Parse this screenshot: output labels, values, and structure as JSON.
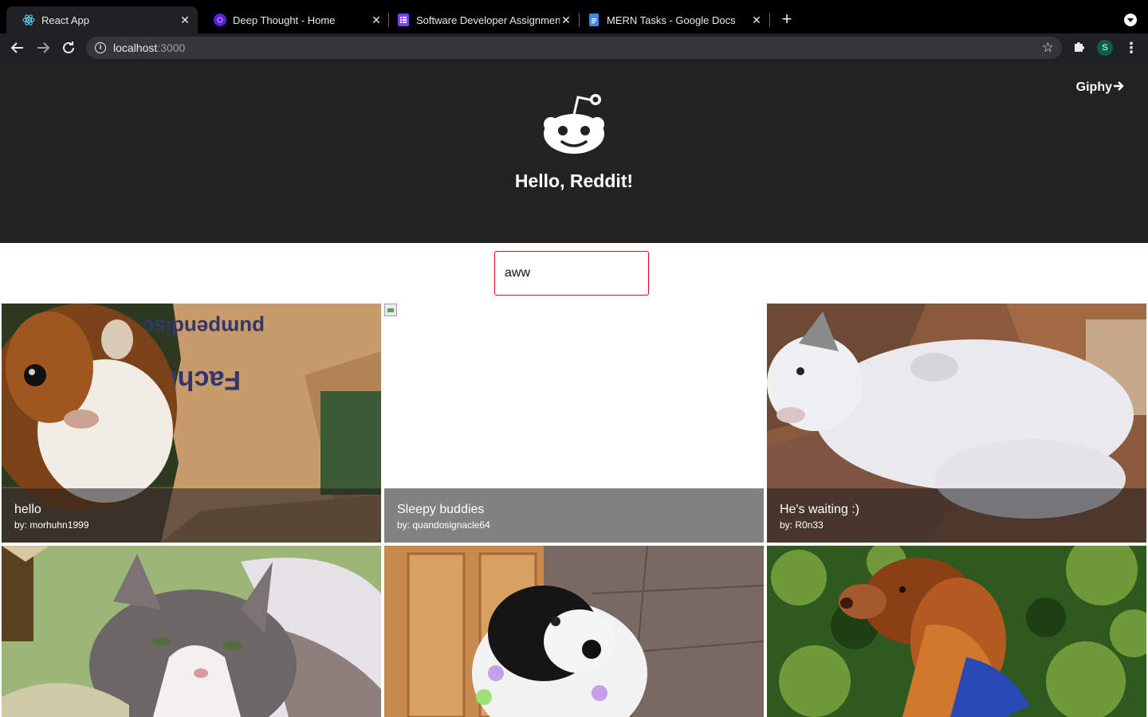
{
  "browser": {
    "tabs": [
      {
        "title": "React App",
        "favicon": "react-icon",
        "active": true
      },
      {
        "title": "Deep Thought - Home",
        "favicon": "deep-thought-icon",
        "active": false
      },
      {
        "title": "Software Developer Assignmen",
        "favicon": "forms-icon",
        "active": false
      },
      {
        "title": "MERN Tasks - Google Docs",
        "favicon": "docs-icon",
        "active": false
      }
    ],
    "url_host": "localhost",
    "url_port": ":3000",
    "profile_initial": "S"
  },
  "header": {
    "giphy_label": "Giphy",
    "title": "Hello, Reddit!",
    "logo_icon": "reddit-alien-icon"
  },
  "search": {
    "value": "aww"
  },
  "posts": [
    {
      "title": "hello",
      "author": "by: morhuhn1999",
      "image": "guinea-pig-in-box"
    },
    {
      "title": "Sleepy buddies",
      "author": "by: quandosignacle64",
      "image": "broken-image"
    },
    {
      "title": "He's waiting :)",
      "author": "by: R0n33",
      "image": "white-dog-lying-on-floor"
    },
    {
      "title": "",
      "author": "",
      "image": "grey-white-cat-in-blanket"
    },
    {
      "title": "",
      "author": "",
      "image": "border-collie-with-lei"
    },
    {
      "title": "",
      "author": "",
      "image": "golden-retriever-in-trees"
    }
  ],
  "colors": {
    "header_bg": "#222222",
    "search_border": "#e5001f",
    "caption_overlay": "rgba(30,30,30,0.55)"
  }
}
